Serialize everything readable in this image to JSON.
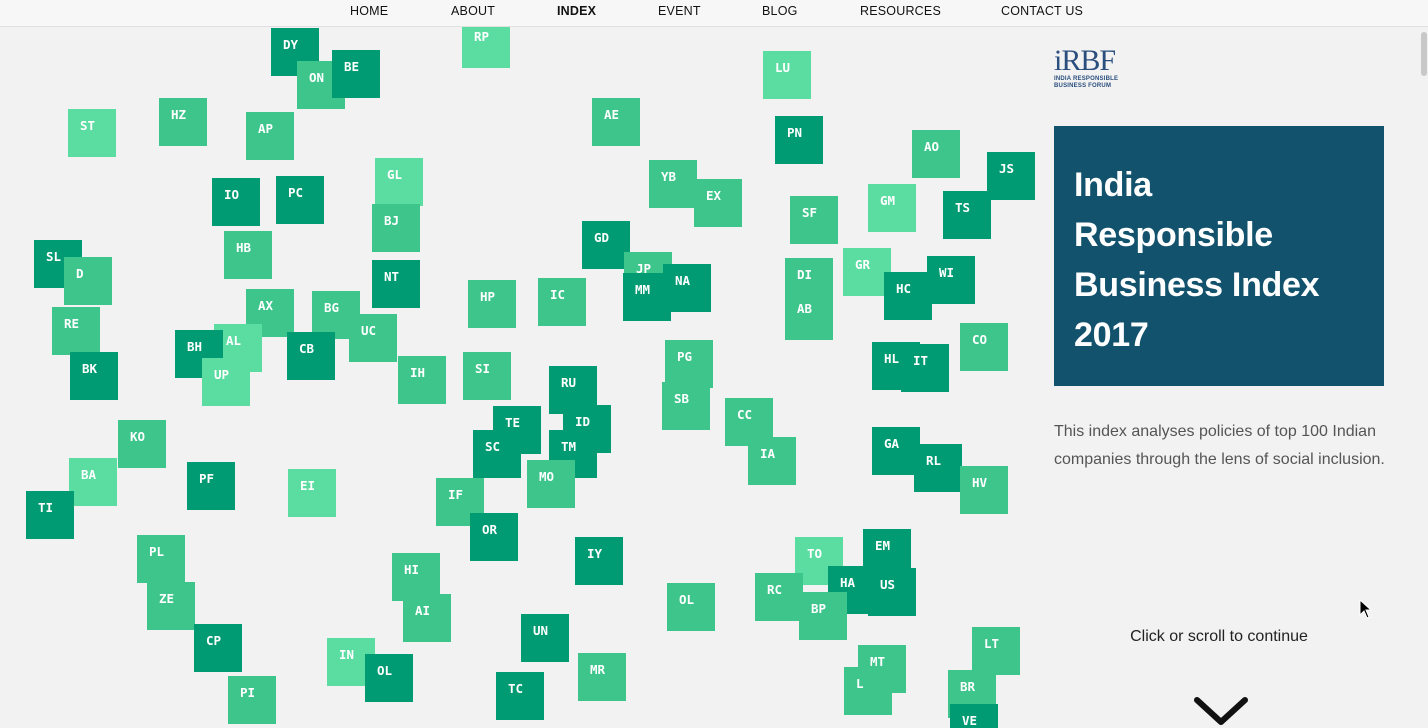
{
  "nav": {
    "items": [
      {
        "label": "HOME",
        "active": false
      },
      {
        "label": "ABOUT",
        "active": false
      },
      {
        "label": "INDEX",
        "active": true
      },
      {
        "label": "EVENT",
        "active": false
      },
      {
        "label": "BLOG",
        "active": false
      },
      {
        "label": "RESOURCES",
        "active": false
      },
      {
        "label": "CONTACT US",
        "active": false
      }
    ]
  },
  "logo": {
    "mark": "iRBF",
    "line1": "INDIA RESPONSIBLE",
    "line2": "BUSINESS FORUM"
  },
  "hero": {
    "title_lines": [
      "India",
      "Responsible",
      "Business Index",
      "2017"
    ],
    "description": "This index analyses policies of top 100 Indian companies through the lens of social inclusion.",
    "scroll_hint": "Click or scroll to continue"
  },
  "colors": {
    "dark_tile": "#009b72",
    "mid_tile": "#3dc58b",
    "light_tile": "#5bdca1",
    "title_box": "#12526d"
  },
  "tiles": [
    {
      "code": "DY",
      "tone": 0
    },
    {
      "code": "ON",
      "tone": 1
    },
    {
      "code": "BE",
      "tone": 0
    },
    {
      "code": "RP",
      "tone": 2
    },
    {
      "code": "LU",
      "tone": 2
    },
    {
      "code": "HZ",
      "tone": 1
    },
    {
      "code": "ST",
      "tone": 2
    },
    {
      "code": "AP",
      "tone": 1
    },
    {
      "code": "AE",
      "tone": 1
    },
    {
      "code": "PN",
      "tone": 0
    },
    {
      "code": "AO",
      "tone": 1
    },
    {
      "code": "JS",
      "tone": 0
    },
    {
      "code": "GL",
      "tone": 2
    },
    {
      "code": "YB",
      "tone": 1
    },
    {
      "code": "EX",
      "tone": 1
    },
    {
      "code": "IO",
      "tone": 0
    },
    {
      "code": "PC",
      "tone": 0
    },
    {
      "code": "BJ",
      "tone": 1
    },
    {
      "code": "GM",
      "tone": 2
    },
    {
      "code": "TS",
      "tone": 0
    },
    {
      "code": "SF",
      "tone": 1
    },
    {
      "code": "HB",
      "tone": 1
    },
    {
      "code": "GD",
      "tone": 0
    },
    {
      "code": "SL",
      "tone": 0
    },
    {
      "code": "D",
      "tone": 1
    },
    {
      "code": "NT",
      "tone": 0
    },
    {
      "code": "JP",
      "tone": 1
    },
    {
      "code": "NA",
      "tone": 0
    },
    {
      "code": "MM",
      "tone": 0
    },
    {
      "code": "DI",
      "tone": 1
    },
    {
      "code": "AB",
      "tone": 1
    },
    {
      "code": "GR",
      "tone": 2
    },
    {
      "code": "WI",
      "tone": 0
    },
    {
      "code": "HC",
      "tone": 0
    },
    {
      "code": "AX",
      "tone": 1
    },
    {
      "code": "BG",
      "tone": 1
    },
    {
      "code": "HP",
      "tone": 1
    },
    {
      "code": "IC",
      "tone": 1
    },
    {
      "code": "RE",
      "tone": 1
    },
    {
      "code": "UC",
      "tone": 1
    },
    {
      "code": "CO",
      "tone": 1
    },
    {
      "code": "AL",
      "tone": 2
    },
    {
      "code": "BH",
      "tone": 0
    },
    {
      "code": "CB",
      "tone": 0
    },
    {
      "code": "UP",
      "tone": 2
    },
    {
      "code": "HL",
      "tone": 0
    },
    {
      "code": "IT",
      "tone": 0
    },
    {
      "code": "PG",
      "tone": 1
    },
    {
      "code": "BK",
      "tone": 0
    },
    {
      "code": "IH",
      "tone": 1
    },
    {
      "code": "SI",
      "tone": 1
    },
    {
      "code": "RU",
      "tone": 0
    },
    {
      "code": "SB",
      "tone": 1
    },
    {
      "code": "TE",
      "tone": 0
    },
    {
      "code": "ID",
      "tone": 0
    },
    {
      "code": "CC",
      "tone": 1
    },
    {
      "code": "KO",
      "tone": 1
    },
    {
      "code": "SC",
      "tone": 0
    },
    {
      "code": "TM",
      "tone": 0
    },
    {
      "code": "IA",
      "tone": 1
    },
    {
      "code": "GA",
      "tone": 0
    },
    {
      "code": "RL",
      "tone": 0
    },
    {
      "code": "BA",
      "tone": 2
    },
    {
      "code": "PF",
      "tone": 0
    },
    {
      "code": "EI",
      "tone": 2
    },
    {
      "code": "MO",
      "tone": 1
    },
    {
      "code": "HV",
      "tone": 1
    },
    {
      "code": "IF",
      "tone": 1
    },
    {
      "code": "TI",
      "tone": 0
    },
    {
      "code": "OR",
      "tone": 0
    },
    {
      "code": "PL",
      "tone": 1
    },
    {
      "code": "IY",
      "tone": 0
    },
    {
      "code": "TO",
      "tone": 2
    },
    {
      "code": "EM",
      "tone": 0
    },
    {
      "code": "HI",
      "tone": 1
    },
    {
      "code": "HA",
      "tone": 0
    },
    {
      "code": "US",
      "tone": 0
    },
    {
      "code": "RC",
      "tone": 1
    },
    {
      "code": "ZE",
      "tone": 1
    },
    {
      "code": "OL",
      "tone": 1
    },
    {
      "code": "BP",
      "tone": 1
    },
    {
      "code": "AI",
      "tone": 1
    },
    {
      "code": "UN",
      "tone": 0
    },
    {
      "code": "CP",
      "tone": 0
    },
    {
      "code": "LT",
      "tone": 1
    },
    {
      "code": "IN",
      "tone": 2
    },
    {
      "code": "OL",
      "tone": 0
    },
    {
      "code": "MR",
      "tone": 1
    },
    {
      "code": "MT",
      "tone": 1
    },
    {
      "code": "L",
      "tone": 1
    },
    {
      "code": "TC",
      "tone": 0
    },
    {
      "code": "PI",
      "tone": 1
    },
    {
      "code": "BR",
      "tone": 1
    },
    {
      "code": "VE",
      "tone": 0
    }
  ]
}
